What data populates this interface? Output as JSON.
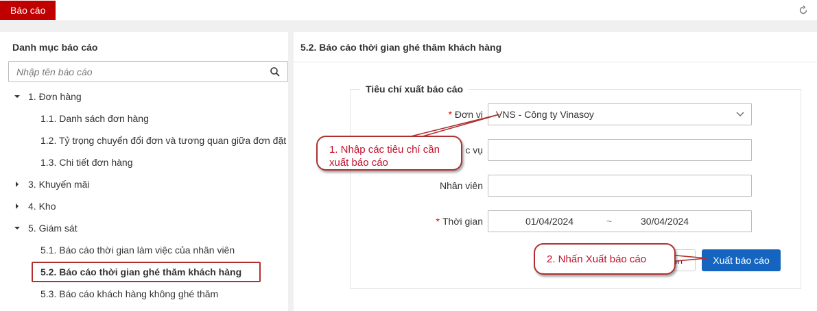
{
  "topbar": {
    "active_tab": "Báo cáo",
    "refresh_icon": "refresh-icon"
  },
  "left": {
    "title": "Danh mục báo cáo",
    "search_placeholder": "Nhập tên báo cáo",
    "tree": [
      {
        "label": "1. Đơn hàng",
        "level": 0,
        "expanded": true
      },
      {
        "label": "1.1. Danh sách đơn hàng",
        "level": 1
      },
      {
        "label": "1.2. Tỷ trọng chuyển đổi đơn và tương quan giữa đơn đặt",
        "level": 1
      },
      {
        "label": "1.3. Chi tiết đơn hàng",
        "level": 1
      },
      {
        "label": "3. Khuyến mãi",
        "level": 0,
        "expanded": false
      },
      {
        "label": "4. Kho",
        "level": 0,
        "expanded": false
      },
      {
        "label": "5. Giám sát",
        "level": 0,
        "expanded": true
      },
      {
        "label": "5.1. Báo cáo thời gian làm việc của nhân viên",
        "level": 1
      },
      {
        "label": "5.2. Báo cáo thời gian ghé thăm khách hàng",
        "level": 1,
        "selected": true
      },
      {
        "label": "5.3. Báo cáo khách hàng không ghé thăm",
        "level": 1
      }
    ]
  },
  "right": {
    "title": "5.2. Báo cáo thời gian ghé thăm khách hàng",
    "legend": "Tiêu chí xuất báo cáo",
    "fields": {
      "don_vi_label": "Đơn vị",
      "don_vi_value": "VNS - Công ty Vinasoy",
      "nghiep_vu_label": "c vụ",
      "nhan_vien_label": "Nhân viên",
      "thoi_gian_label": "Thời gian",
      "date_from": "01/04/2024",
      "date_sep": "~",
      "date_to": "30/04/2024"
    },
    "buttons": {
      "secondary": "nh",
      "export": "Xuất báo cáo"
    }
  },
  "callouts": {
    "step1_line1": "1. Nhập các tiêu chí cần",
    "step1_line2": "xuất báo cáo",
    "step2": "2. Nhấn Xuất báo cáo"
  },
  "colors": {
    "brand_red": "#c00000",
    "primary_blue": "#1565c0",
    "callout_red": "#b03030"
  }
}
